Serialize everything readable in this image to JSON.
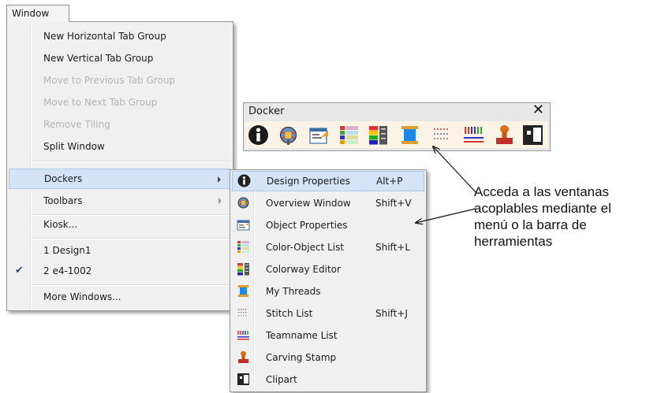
{
  "menubar": {
    "window_label": "Window"
  },
  "window_menu": {
    "items": [
      {
        "label": "New Horizontal Tab Group",
        "enabled": true
      },
      {
        "label": "New Vertical Tab Group",
        "enabled": true
      },
      {
        "label": "Move to Previous Tab Group",
        "enabled": false
      },
      {
        "label": "Move to Next Tab Group",
        "enabled": false
      },
      {
        "label": "Remove Tiling",
        "enabled": false
      },
      {
        "label": "Split Window",
        "enabled": true
      },
      {
        "label": "Dockers",
        "enabled": true,
        "submenu": true,
        "highlighted": true
      },
      {
        "label": "Toolbars",
        "enabled": true,
        "submenu": true
      },
      {
        "label": "Kiosk...",
        "enabled": true
      },
      {
        "label": "1 Design1",
        "enabled": true
      },
      {
        "label": "2 e4-1002",
        "enabled": true,
        "checked": true
      },
      {
        "label": "More Windows...",
        "enabled": true
      }
    ],
    "check_mark": "✔"
  },
  "docker_menu": {
    "items": [
      {
        "label": "Design Properties",
        "shortcut": "Alt+P",
        "icon": "info-icon",
        "highlighted": true
      },
      {
        "label": "Overview Window",
        "shortcut": "Shift+V",
        "icon": "overview-icon"
      },
      {
        "label": "Object Properties",
        "shortcut": "",
        "icon": "object-properties-icon"
      },
      {
        "label": "Color-Object List",
        "shortcut": "Shift+L",
        "icon": "color-object-list-icon"
      },
      {
        "label": "Colorway Editor",
        "shortcut": "",
        "icon": "colorway-editor-icon"
      },
      {
        "label": "My Threads",
        "shortcut": "",
        "icon": "thread-spool-icon"
      },
      {
        "label": "Stitch List",
        "shortcut": "Shift+J",
        "icon": "stitch-list-icon"
      },
      {
        "label": "Teamname List",
        "shortcut": "",
        "icon": "teamname-list-icon"
      },
      {
        "label": "Carving Stamp",
        "shortcut": "",
        "icon": "carving-stamp-icon"
      },
      {
        "label": "Clipart",
        "shortcut": "",
        "icon": "clipart-icon"
      }
    ]
  },
  "docker_toolbar": {
    "title": "Docker",
    "close_glyph": "✕",
    "buttons": [
      "info-icon",
      "overview-icon",
      "object-properties-icon",
      "color-object-list-icon",
      "colorway-editor-icon",
      "thread-spool-icon",
      "stitch-list-icon",
      "teamname-list-icon",
      "carving-stamp-icon",
      "clipart-icon"
    ]
  },
  "callout": {
    "lines": [
      "Acceda a las ventanas",
      "acoplables mediante el",
      "menú o la barra de",
      "herramientas"
    ]
  },
  "colors": {
    "highlight_bg": "#d4e4f6",
    "menu_bg": "#f0f0f0",
    "toolbar_row_bg": "#fbf3e6",
    "disabled_text": "#b4b4b4"
  }
}
